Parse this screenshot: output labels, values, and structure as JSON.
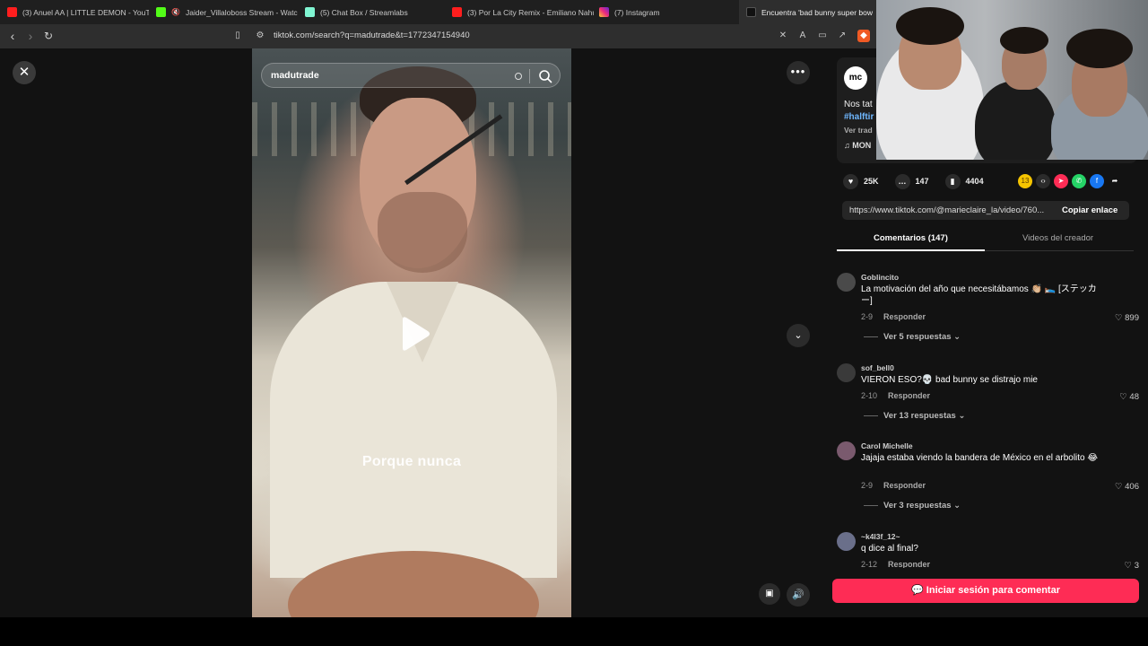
{
  "browser": {
    "tabs": [
      {
        "title": "(3) Anuel AA | LITTLE DEMON - YouTu"
      },
      {
        "title": "Jaider_Villaloboss Stream - Watch"
      },
      {
        "title": "(5) Chat Box / Streamlabs"
      },
      {
        "title": "(3) Por La City Remix - Emiliano Nahu"
      },
      {
        "title": "(7) Instagram"
      },
      {
        "title": "Encuentra 'bad bunny super bow"
      }
    ],
    "url": "tiktok.com/search?q=madutrade&t=1772347154940"
  },
  "video": {
    "search_query": "madutrade",
    "caption": "Porque nunca"
  },
  "author": {
    "avatar_text": "mc",
    "description": "Nos tat",
    "hashtag": "#halftir",
    "translate": "Ver trad",
    "music": "MON"
  },
  "actions": {
    "likes": "25K",
    "comments": "147",
    "saves": "4404",
    "share_coin": "13"
  },
  "link": {
    "url": "https://www.tiktok.com/@marieclaire_la/video/760...",
    "copy_label": "Copiar enlace"
  },
  "tabs": {
    "comments": "Comentarios (147)",
    "creator": "Videos del creador"
  },
  "comments": [
    {
      "user": "Goblincito",
      "text": "La motivación del año que necesitábamos 👏🏼 🛌 [ステッカー]",
      "date": "2-9",
      "reply": "Responder",
      "likes": "899",
      "more": "Ver 5 respuestas"
    },
    {
      "user": "sof_bell0",
      "text": "VIERON ESO?💀 bad bunny se distrajo mie",
      "date": "2-10",
      "reply": "Responder",
      "likes": "48",
      "more": "Ver 13 respuestas"
    },
    {
      "user": "Carol Michelle",
      "text": "Jajaja estaba viendo la bandera de México en el arbolito 😂",
      "date": "2-9",
      "reply": "Responder",
      "likes": "406",
      "more": "Ver 3 respuestas"
    },
    {
      "user": "~k4l3f_12~",
      "text": "q dice al final?",
      "date": "2-12",
      "reply": "Responder",
      "likes": "3"
    }
  ],
  "login_button": "Iniciar sesión para comentar",
  "colors": {
    "accent": "#fe2c55",
    "link": "#6fb7ff",
    "background": "#121212"
  }
}
